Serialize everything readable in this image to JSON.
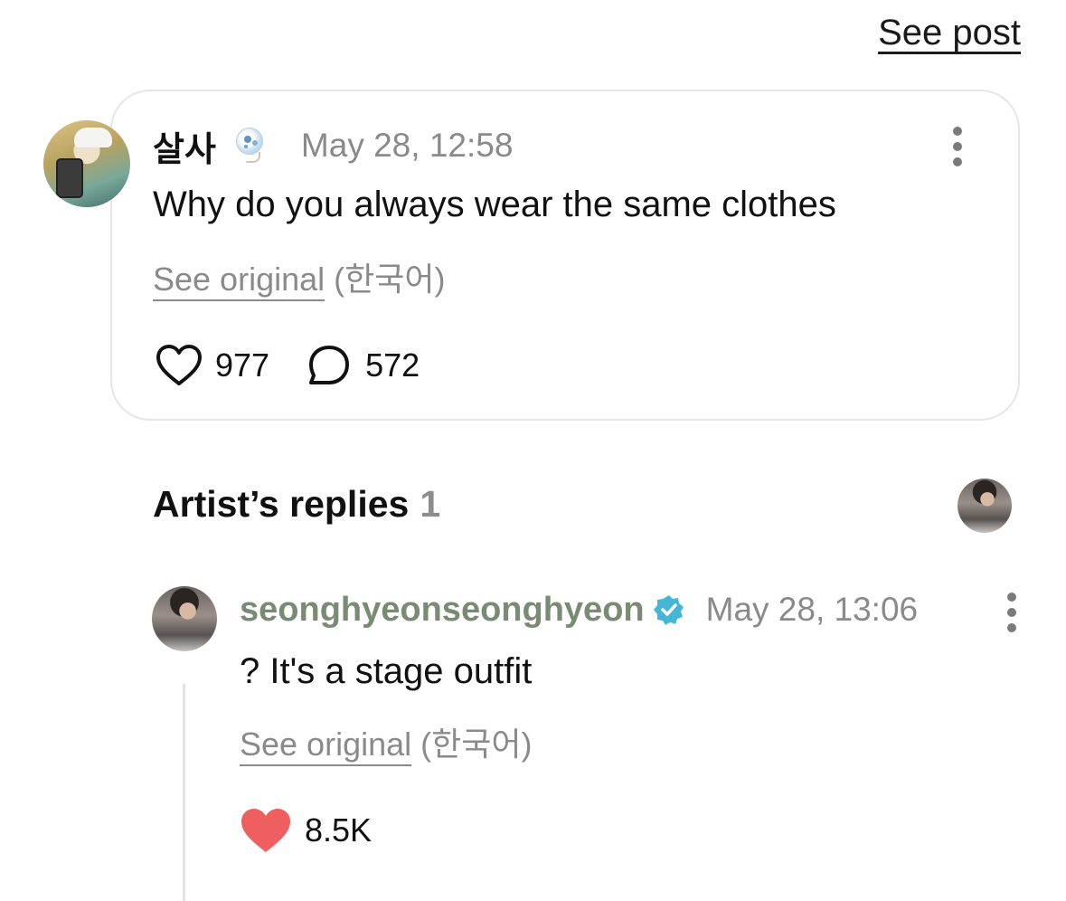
{
  "header": {
    "see_post_label": "See post"
  },
  "post": {
    "username": "살사",
    "timestamp": "May 28, 12:58",
    "text": "Why do you always wear the same clothes",
    "see_original_label": "See original",
    "original_language": "(한국어)",
    "likes": "977",
    "comments": "572",
    "like_icon": "heart-outline-icon",
    "comment_icon": "speech-bubble-icon"
  },
  "artist_replies": {
    "title": "Artist’s replies",
    "count": "1"
  },
  "reply": {
    "username": "seonghyeonseonghyeon",
    "timestamp": "May 28, 13:06",
    "text": "? It's a stage outfit",
    "see_original_label": "See original",
    "original_language": "(한국어)",
    "likes": "8.5K",
    "like_icon": "heart-filled-icon",
    "verified_icon": "verified-badge-icon"
  },
  "colors": {
    "liked_heart": "#ef5f5f",
    "artist_name": "#7a8b74",
    "verified_badge": "#45b6d6",
    "muted_text": "#8a8a8a",
    "card_border": "#e6e6e6"
  }
}
